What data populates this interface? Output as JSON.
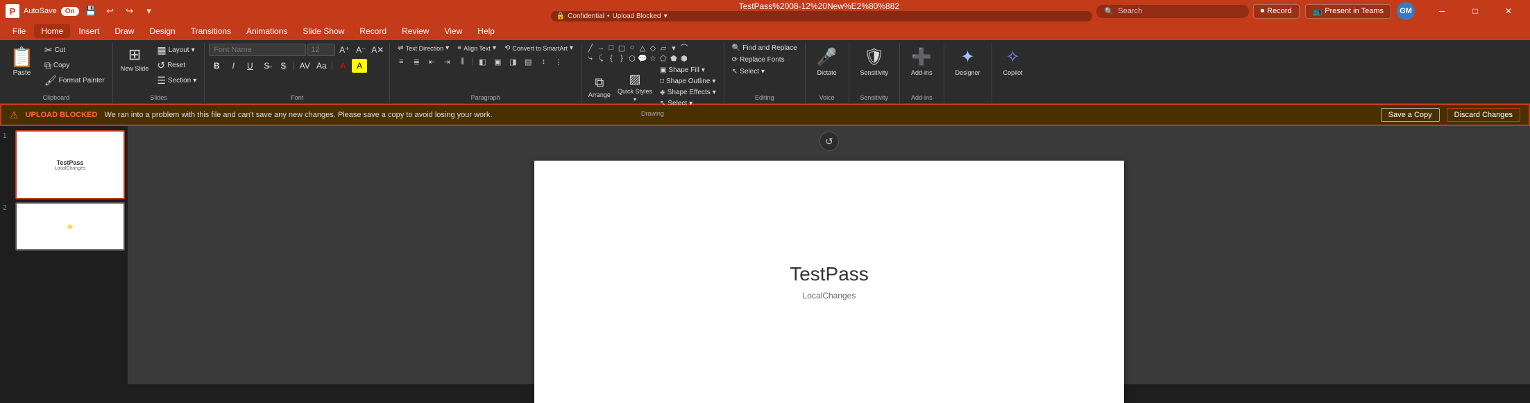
{
  "titlebar": {
    "app_icon": "P",
    "autosave_label": "AutoSave",
    "autosave_state": "On",
    "file_name": "TestPass%2008-12%20New%E2%80%882",
    "confidential_label": "Confidential",
    "upload_status": "Upload Blocked",
    "search_placeholder": "Search",
    "record_label": "Record",
    "present_label": "Present in Teams",
    "avatar_initials": "GM"
  },
  "menu": {
    "items": [
      "File",
      "Home",
      "Insert",
      "Draw",
      "Design",
      "Transitions",
      "Animations",
      "Slide Show",
      "Record",
      "Review",
      "View",
      "Help"
    ]
  },
  "ribbon": {
    "groups": {
      "clipboard": {
        "label": "Clipboard",
        "paste_label": "Paste",
        "cut_label": "Cut",
        "copy_label": "Copy",
        "format_painter_label": "Format Painter"
      },
      "slides": {
        "label": "Slides",
        "new_slide_label": "New Slide",
        "layout_label": "Layout",
        "reset_label": "Reset",
        "section_label": "Section"
      },
      "font": {
        "label": "Font",
        "font_name": "",
        "font_size": "",
        "increase_label": "A",
        "decrease_label": "A",
        "clear_label": "A",
        "bold_label": "B",
        "italic_label": "I",
        "underline_label": "U",
        "strikethrough_label": "S",
        "shadow_label": "S",
        "spacing_label": "AV",
        "case_label": "Aa",
        "color_label": "A",
        "highlight_label": "A"
      },
      "paragraph": {
        "label": "Paragraph",
        "direction_label": "Text Direction",
        "align_text_label": "Align Text",
        "convert_label": "Convert to SmartArt"
      },
      "drawing": {
        "label": "Drawing",
        "arrange_label": "Arrange",
        "quick_styles_label": "Quick Styles",
        "shape_fill_label": "Shape Fill",
        "shape_outline_label": "Shape Outline",
        "shape_effects_label": "Shape Effects",
        "select_label": "Select"
      },
      "editing": {
        "label": "Editing",
        "find_replace_label": "Find and Replace",
        "replace_fonts_label": "Replace Fonts",
        "select_menu_label": "Select"
      },
      "voice": {
        "label": "Voice",
        "dictate_label": "Dictate"
      },
      "sensitivity": {
        "label": "Sensitivity",
        "sensitivity_label": "Sensitivity"
      },
      "addins": {
        "label": "Add-ins",
        "addins_label": "Add-ins"
      },
      "designer": {
        "label": "",
        "designer_label": "Designer"
      },
      "copilot": {
        "label": "",
        "copilot_label": "Copilot"
      }
    }
  },
  "upload_blocked": {
    "title": "UPLOAD BLOCKED",
    "message": "We ran into a problem with this file and can't save any new changes. Please save a copy to avoid losing your work.",
    "save_copy_label": "Save a Copy",
    "discard_label": "Discard Changes"
  },
  "slide_panel": {
    "slides": [
      {
        "number": "1",
        "title": "TestPass",
        "subtitle": "LocalChanges",
        "selected": true
      },
      {
        "number": "2",
        "title": "",
        "subtitle": "",
        "selected": false
      }
    ]
  },
  "canvas": {
    "slide_title": "TestPass",
    "slide_subtitle": "LocalChanges"
  },
  "icons": {
    "search": "🔍",
    "record": "⏺",
    "present": "📺",
    "paste": "📋",
    "cut": "✂",
    "copy": "⧉",
    "format_painter": "🖌",
    "new_slide": "⊞",
    "layout": "▦",
    "reset": "↺",
    "section": "☰",
    "bold": "B",
    "italic": "I",
    "underline": "U",
    "strikethrough": "S",
    "font_increase": "A↑",
    "font_decrease": "A↓",
    "font_clear": "A✕",
    "text_direction": "⇌",
    "align_text": "≡",
    "convert_smartart": "⟲",
    "arrange": "⧉",
    "quick_styles": "▨",
    "shape_fill": "▣",
    "shape_outline": "□",
    "shape_effects": "◈",
    "find_replace": "🔍",
    "replace_fonts": "⟳",
    "dictate": "🎤",
    "sensitivity": "🛡",
    "addins": "➕",
    "designer": "✦",
    "copilot": "✧",
    "select": "↖",
    "alert": "⚠",
    "chevron_down": "▾",
    "undo": "↩",
    "redo": "↪",
    "minimize": "─",
    "maximize": "□",
    "close": "✕"
  }
}
